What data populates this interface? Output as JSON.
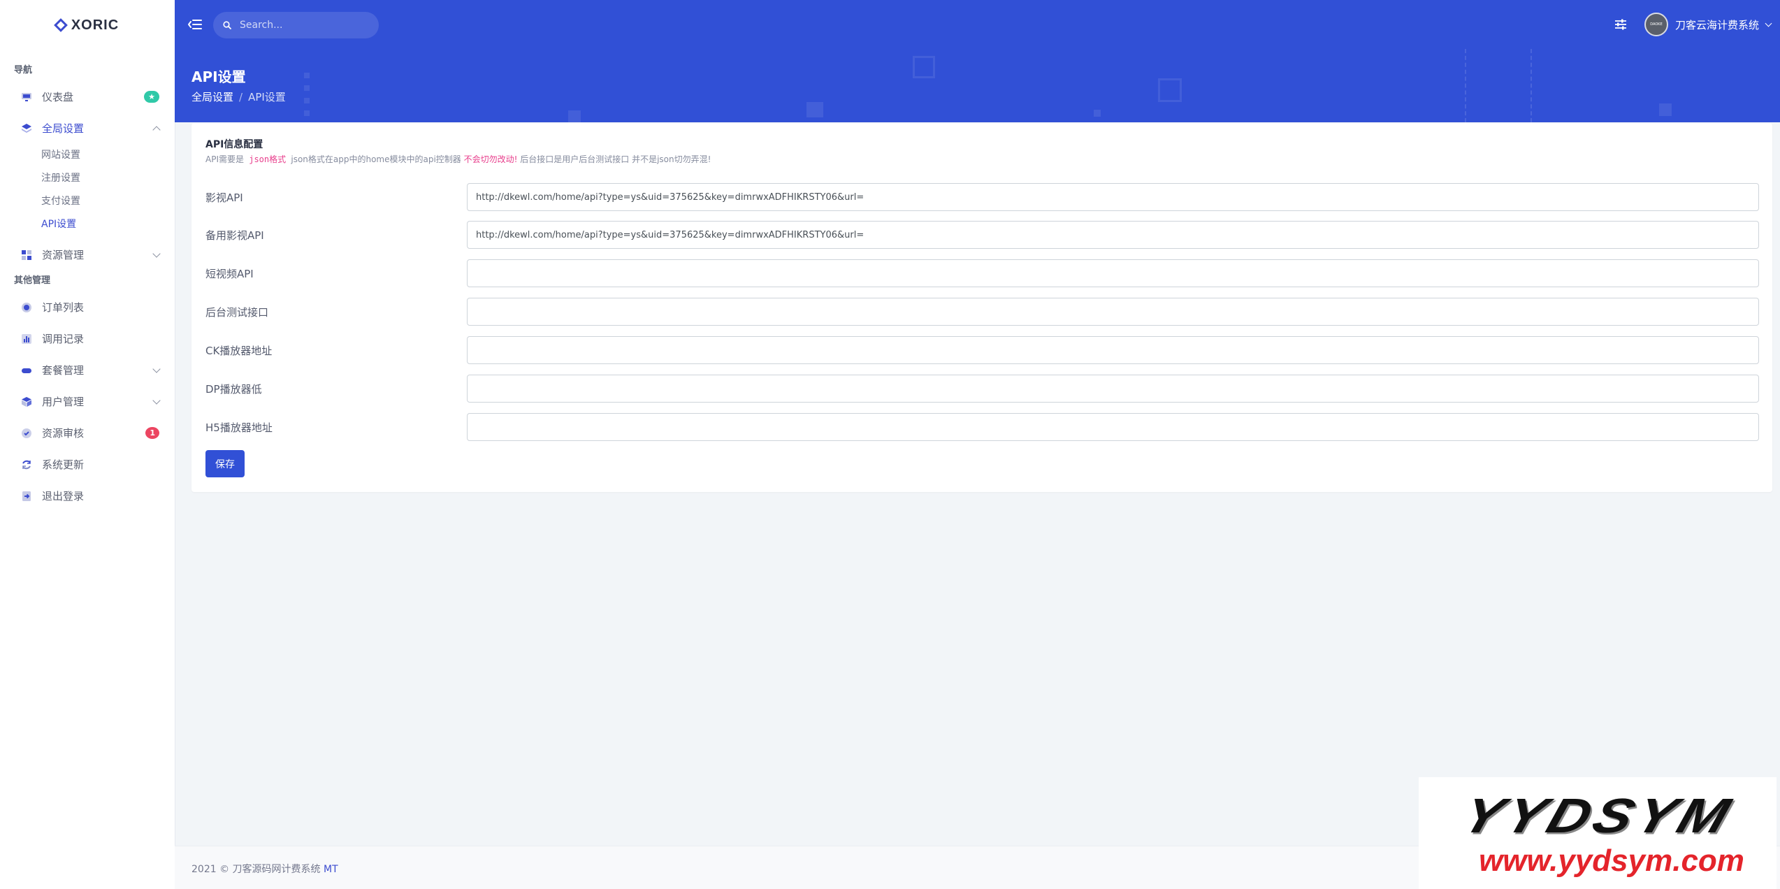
{
  "brand": {
    "name": "XORIC"
  },
  "sidebar": {
    "section_nav": "导航",
    "dashboard": {
      "label": "仪表盘",
      "badge": "★"
    },
    "global_settings": {
      "label": "全局设置",
      "children": [
        "网站设置",
        "注册设置",
        "支付设置",
        "API设置"
      ]
    },
    "resource_management": {
      "label": "资源管理"
    },
    "section_other": "其他管理",
    "orders": {
      "label": "订单列表"
    },
    "call_logs": {
      "label": "调用记录"
    },
    "packages": {
      "label": "套餐管理"
    },
    "users": {
      "label": "用户管理"
    },
    "resource_review": {
      "label": "资源审核",
      "badge": "1"
    },
    "system_update": {
      "label": "系统更新"
    },
    "logout": {
      "label": "退出登录"
    }
  },
  "header": {
    "search_placeholder": "Search...",
    "user_name": "刀客云海计费系统",
    "avatar_text": "DAOKE"
  },
  "page": {
    "title": "API设置",
    "breadcrumb": [
      "全局设置",
      "API设置"
    ]
  },
  "card": {
    "title": "API信息配置",
    "desc_prefix": "API需要是",
    "desc_code": " json格式 ",
    "desc_middle": "json格式在app中的home模块中的api控制器",
    "desc_warn": " 不会切勿改动! ",
    "desc_suffix": " 后台接口是用户后台测试接口 并不是json切勿弄混!",
    "fields": [
      {
        "label": "影视API",
        "value": "http://dkewl.com/home/api?type=ys&uid=375625&key=dimrwxADFHIKRSTY06&url="
      },
      {
        "label": "备用影视API",
        "value": "http://dkewl.com/home/api?type=ys&uid=375625&key=dimrwxADFHIKRSTY06&url="
      },
      {
        "label": "短视频API",
        "value": ""
      },
      {
        "label": "后台测试接口",
        "value": ""
      },
      {
        "label": "CK播放器地址",
        "value": ""
      },
      {
        "label": "DP播放器低",
        "value": ""
      },
      {
        "label": "H5播放器地址",
        "value": ""
      }
    ],
    "save_label": "保存"
  },
  "footer": {
    "copyright": "2021 © 刀客源码网计费系统 ",
    "suffix": "MT"
  },
  "watermark": {
    "main": "YYDSYM",
    "url": "www.yydsym.com"
  },
  "colors": {
    "primary": "#3150d6",
    "accent": "#3c4ccf",
    "success": "#30c9a8",
    "danger": "#ec4561",
    "warn_text": "#e83e8c"
  }
}
